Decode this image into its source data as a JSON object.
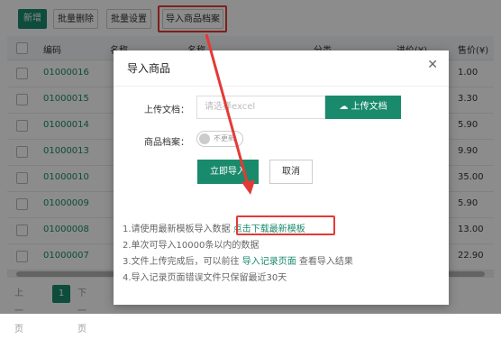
{
  "toolbar": {
    "add": "新增",
    "batch_delete": "批量删除",
    "batch_settings": "批量设置",
    "import_archive": "导入商品档案"
  },
  "table": {
    "headers": [
      "编码",
      "名称",
      "分类",
      "进价(¥)",
      "售价(¥)"
    ],
    "rows": [
      {
        "code": "01000016",
        "price": "1.00"
      },
      {
        "code": "01000015",
        "price": "3.30"
      },
      {
        "code": "01000014",
        "price": "5.90"
      },
      {
        "code": "01000013",
        "price": "9.90"
      },
      {
        "code": "01000010",
        "price": "35.00"
      },
      {
        "code": "01000009",
        "price": "5.90"
      },
      {
        "code": "01000008",
        "price": "13.00"
      },
      {
        "code": "01000007",
        "price": "22.90"
      }
    ]
  },
  "pager": {
    "prev": "上一页",
    "current": "1",
    "next": "下一页"
  },
  "modal": {
    "title": "导入商品",
    "upload_label": "上传文档：",
    "upload_placeholder": "请选择excel",
    "upload_button": "上传文档",
    "archive_label": "商品档案：",
    "toggle_text": "不更新",
    "import_button": "立即导入",
    "cancel_button": "取消",
    "notes": {
      "n1": "1.请使用最新模板导入数据",
      "n1_link": "点击下载最新模板",
      "n2": "2.单次可导入10000条以内的数据",
      "n3_a": "3.文件上传完成后，可以前往",
      "n3_link": "导入记录页面",
      "n3_b": "查看导入结果",
      "n4": "4.导入记录页面错误文件只保留最近30天"
    }
  },
  "colors": {
    "accent": "#1a8a6c",
    "highlight": "#e53935"
  },
  "icons": [
    "close-icon",
    "cloud-upload-icon",
    "arrow-annotation"
  ]
}
